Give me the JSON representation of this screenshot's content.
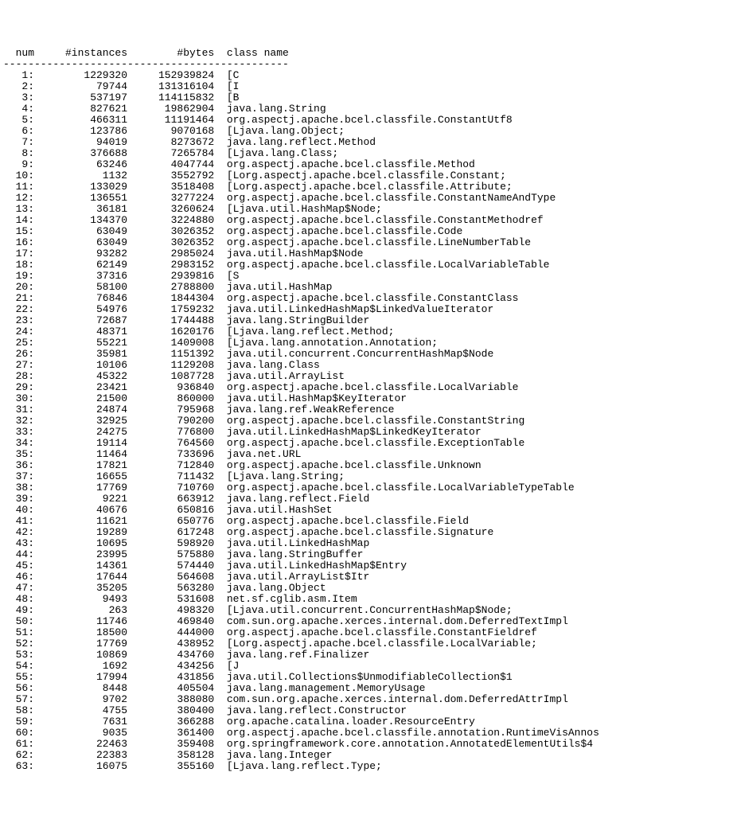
{
  "headers": {
    "num": "num",
    "instances": "#instances",
    "bytes": "#bytes",
    "className": "class name"
  },
  "separator": "----------------------------------------------",
  "rows": [
    {
      "num": "1:",
      "inst": "1229320",
      "bytes": "152939824",
      "cls": "[C"
    },
    {
      "num": "2:",
      "inst": "79744",
      "bytes": "131316104",
      "cls": "[I"
    },
    {
      "num": "3:",
      "inst": "537197",
      "bytes": "114115832",
      "cls": "[B"
    },
    {
      "num": "4:",
      "inst": "827621",
      "bytes": "19862904",
      "cls": "java.lang.String"
    },
    {
      "num": "5:",
      "inst": "466311",
      "bytes": "11191464",
      "cls": "org.aspectj.apache.bcel.classfile.ConstantUtf8"
    },
    {
      "num": "6:",
      "inst": "123786",
      "bytes": "9070168",
      "cls": "[Ljava.lang.Object;"
    },
    {
      "num": "7:",
      "inst": "94019",
      "bytes": "8273672",
      "cls": "java.lang.reflect.Method"
    },
    {
      "num": "8:",
      "inst": "376688",
      "bytes": "7265784",
      "cls": "[Ljava.lang.Class;"
    },
    {
      "num": "9:",
      "inst": "63246",
      "bytes": "4047744",
      "cls": "org.aspectj.apache.bcel.classfile.Method"
    },
    {
      "num": "10:",
      "inst": "1132",
      "bytes": "3552792",
      "cls": "[Lorg.aspectj.apache.bcel.classfile.Constant;"
    },
    {
      "num": "11:",
      "inst": "133029",
      "bytes": "3518408",
      "cls": "[Lorg.aspectj.apache.bcel.classfile.Attribute;"
    },
    {
      "num": "12:",
      "inst": "136551",
      "bytes": "3277224",
      "cls": "org.aspectj.apache.bcel.classfile.ConstantNameAndType"
    },
    {
      "num": "13:",
      "inst": "36181",
      "bytes": "3260624",
      "cls": "[Ljava.util.HashMap$Node;"
    },
    {
      "num": "14:",
      "inst": "134370",
      "bytes": "3224880",
      "cls": "org.aspectj.apache.bcel.classfile.ConstantMethodref"
    },
    {
      "num": "15:",
      "inst": "63049",
      "bytes": "3026352",
      "cls": "org.aspectj.apache.bcel.classfile.Code"
    },
    {
      "num": "16:",
      "inst": "63049",
      "bytes": "3026352",
      "cls": "org.aspectj.apache.bcel.classfile.LineNumberTable"
    },
    {
      "num": "17:",
      "inst": "93282",
      "bytes": "2985024",
      "cls": "java.util.HashMap$Node"
    },
    {
      "num": "18:",
      "inst": "62149",
      "bytes": "2983152",
      "cls": "org.aspectj.apache.bcel.classfile.LocalVariableTable"
    },
    {
      "num": "19:",
      "inst": "37316",
      "bytes": "2939816",
      "cls": "[S"
    },
    {
      "num": "20:",
      "inst": "58100",
      "bytes": "2788800",
      "cls": "java.util.HashMap"
    },
    {
      "num": "21:",
      "inst": "76846",
      "bytes": "1844304",
      "cls": "org.aspectj.apache.bcel.classfile.ConstantClass"
    },
    {
      "num": "22:",
      "inst": "54976",
      "bytes": "1759232",
      "cls": "java.util.LinkedHashMap$LinkedValueIterator"
    },
    {
      "num": "23:",
      "inst": "72687",
      "bytes": "1744488",
      "cls": "java.lang.StringBuilder"
    },
    {
      "num": "24:",
      "inst": "48371",
      "bytes": "1620176",
      "cls": "[Ljava.lang.reflect.Method;"
    },
    {
      "num": "25:",
      "inst": "55221",
      "bytes": "1409008",
      "cls": "[Ljava.lang.annotation.Annotation;"
    },
    {
      "num": "26:",
      "inst": "35981",
      "bytes": "1151392",
      "cls": "java.util.concurrent.ConcurrentHashMap$Node"
    },
    {
      "num": "27:",
      "inst": "10106",
      "bytes": "1129208",
      "cls": "java.lang.Class"
    },
    {
      "num": "28:",
      "inst": "45322",
      "bytes": "1087728",
      "cls": "java.util.ArrayList"
    },
    {
      "num": "29:",
      "inst": "23421",
      "bytes": "936840",
      "cls": "org.aspectj.apache.bcel.classfile.LocalVariable"
    },
    {
      "num": "30:",
      "inst": "21500",
      "bytes": "860000",
      "cls": "java.util.HashMap$KeyIterator"
    },
    {
      "num": "31:",
      "inst": "24874",
      "bytes": "795968",
      "cls": "java.lang.ref.WeakReference"
    },
    {
      "num": "32:",
      "inst": "32925",
      "bytes": "790200",
      "cls": "org.aspectj.apache.bcel.classfile.ConstantString"
    },
    {
      "num": "33:",
      "inst": "24275",
      "bytes": "776800",
      "cls": "java.util.LinkedHashMap$LinkedKeyIterator"
    },
    {
      "num": "34:",
      "inst": "19114",
      "bytes": "764560",
      "cls": "org.aspectj.apache.bcel.classfile.ExceptionTable"
    },
    {
      "num": "35:",
      "inst": "11464",
      "bytes": "733696",
      "cls": "java.net.URL"
    },
    {
      "num": "36:",
      "inst": "17821",
      "bytes": "712840",
      "cls": "org.aspectj.apache.bcel.classfile.Unknown"
    },
    {
      "num": "37:",
      "inst": "16655",
      "bytes": "711432",
      "cls": "[Ljava.lang.String;"
    },
    {
      "num": "38:",
      "inst": "17769",
      "bytes": "710760",
      "cls": "org.aspectj.apache.bcel.classfile.LocalVariableTypeTable"
    },
    {
      "num": "39:",
      "inst": "9221",
      "bytes": "663912",
      "cls": "java.lang.reflect.Field"
    },
    {
      "num": "40:",
      "inst": "40676",
      "bytes": "650816",
      "cls": "java.util.HashSet"
    },
    {
      "num": "41:",
      "inst": "11621",
      "bytes": "650776",
      "cls": "org.aspectj.apache.bcel.classfile.Field"
    },
    {
      "num": "42:",
      "inst": "19289",
      "bytes": "617248",
      "cls": "org.aspectj.apache.bcel.classfile.Signature"
    },
    {
      "num": "43:",
      "inst": "10695",
      "bytes": "598920",
      "cls": "java.util.LinkedHashMap"
    },
    {
      "num": "44:",
      "inst": "23995",
      "bytes": "575880",
      "cls": "java.lang.StringBuffer"
    },
    {
      "num": "45:",
      "inst": "14361",
      "bytes": "574440",
      "cls": "java.util.LinkedHashMap$Entry"
    },
    {
      "num": "46:",
      "inst": "17644",
      "bytes": "564608",
      "cls": "java.util.ArrayList$Itr"
    },
    {
      "num": "47:",
      "inst": "35205",
      "bytes": "563280",
      "cls": "java.lang.Object"
    },
    {
      "num": "48:",
      "inst": "9493",
      "bytes": "531608",
      "cls": "net.sf.cglib.asm.Item"
    },
    {
      "num": "49:",
      "inst": "263",
      "bytes": "498320",
      "cls": "[Ljava.util.concurrent.ConcurrentHashMap$Node;"
    },
    {
      "num": "50:",
      "inst": "11746",
      "bytes": "469840",
      "cls": "com.sun.org.apache.xerces.internal.dom.DeferredTextImpl"
    },
    {
      "num": "51:",
      "inst": "18500",
      "bytes": "444000",
      "cls": "org.aspectj.apache.bcel.classfile.ConstantFieldref"
    },
    {
      "num": "52:",
      "inst": "17769",
      "bytes": "438952",
      "cls": "[Lorg.aspectj.apache.bcel.classfile.LocalVariable;"
    },
    {
      "num": "53:",
      "inst": "10869",
      "bytes": "434760",
      "cls": "java.lang.ref.Finalizer"
    },
    {
      "num": "54:",
      "inst": "1692",
      "bytes": "434256",
      "cls": "[J"
    },
    {
      "num": "55:",
      "inst": "17994",
      "bytes": "431856",
      "cls": "java.util.Collections$UnmodifiableCollection$1"
    },
    {
      "num": "56:",
      "inst": "8448",
      "bytes": "405504",
      "cls": "java.lang.management.MemoryUsage"
    },
    {
      "num": "57:",
      "inst": "9702",
      "bytes": "388080",
      "cls": "com.sun.org.apache.xerces.internal.dom.DeferredAttrImpl"
    },
    {
      "num": "58:",
      "inst": "4755",
      "bytes": "380400",
      "cls": "java.lang.reflect.Constructor"
    },
    {
      "num": "59:",
      "inst": "7631",
      "bytes": "366288",
      "cls": "org.apache.catalina.loader.ResourceEntry"
    },
    {
      "num": "60:",
      "inst": "9035",
      "bytes": "361400",
      "cls": "org.aspectj.apache.bcel.classfile.annotation.RuntimeVisAnnos"
    },
    {
      "num": "61:",
      "inst": "22463",
      "bytes": "359408",
      "cls": "org.springframework.core.annotation.AnnotatedElementUtils$4"
    },
    {
      "num": "62:",
      "inst": "22383",
      "bytes": "358128",
      "cls": "java.lang.Integer"
    },
    {
      "num": "63:",
      "inst": "16075",
      "bytes": "355160",
      "cls": "[Ljava.lang.reflect.Type;"
    }
  ]
}
